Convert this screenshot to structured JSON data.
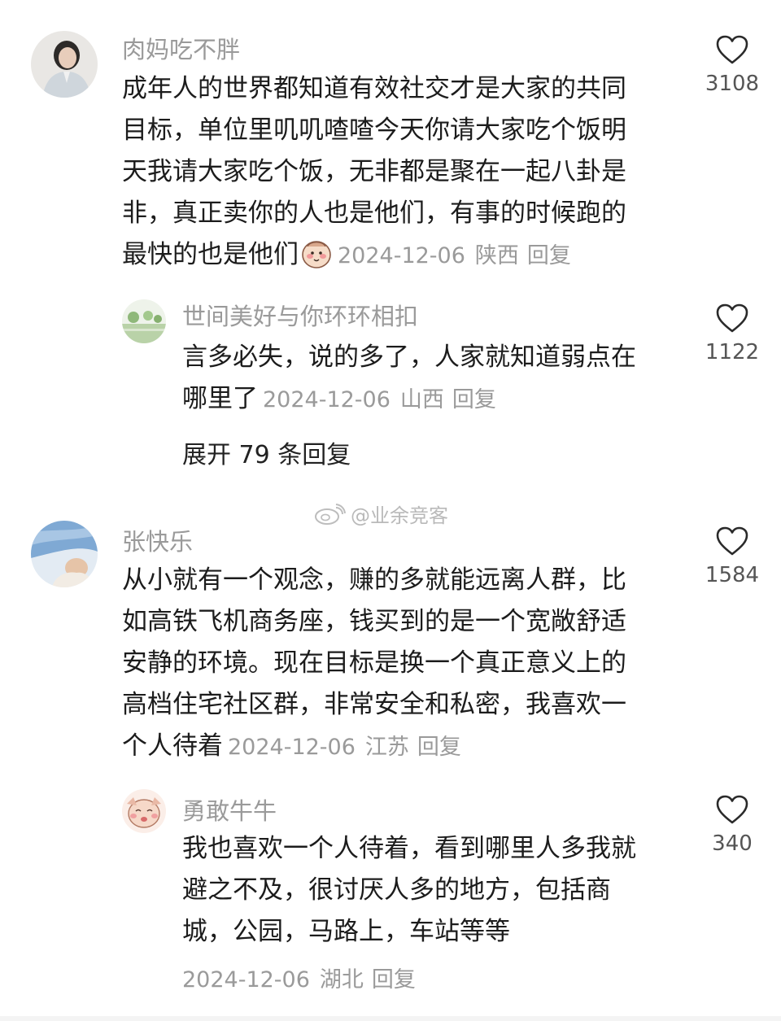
{
  "comments": [
    {
      "username": "肉妈吃不胖",
      "lines": [
        "成年人的世界都知道有效社交才是大家的共同",
        "目标，单位里叽叽喳喳今天你请大家吃个饭明",
        "天我请大家吃个饭，无非都是聚在一起八卦是",
        "非，真正卖你的人也是他们，有事的时候跑的",
        "最快的也是他们"
      ],
      "date": "2024-12-06",
      "location": "陕西",
      "reply_label": "回复",
      "likes": "3108"
    },
    {
      "username": "世间美好与你环环相扣",
      "lines": [
        "言多必失，说的多了，人家就知道弱点在",
        "哪里了"
      ],
      "date": "2024-12-06",
      "location": "山西",
      "reply_label": "回复",
      "likes": "1122"
    },
    {
      "username": "张快乐",
      "lines": [
        "从小就有一个观念，赚的多就能远离人群，比",
        "如高铁飞机商务座，钱买到的是一个宽敞舒适",
        "安静的环境。现在目标是换一个真正意义上的",
        "高档住宅社区群，非常安全和私密，我喜欢一",
        "个人待着"
      ],
      "date": "2024-12-06",
      "location": "江苏",
      "reply_label": "回复",
      "likes": "1584"
    },
    {
      "username": "勇敢牛牛",
      "lines": [
        "我也喜欢一个人待着，看到哪里人多我就",
        "避之不及，很讨厌人多的地方，包括商",
        "城，公园，马路上，车站等等"
      ],
      "date": "2024-12-06",
      "location": "湖北",
      "reply_label": "回复",
      "likes": "340"
    }
  ],
  "expand_replies": "展开 79 条回复",
  "watermark": "@业余竞客",
  "icons": {
    "like": "heart-outline-icon",
    "emoji": "blush-face-emoji",
    "watermark": "weibo-logo-icon"
  }
}
